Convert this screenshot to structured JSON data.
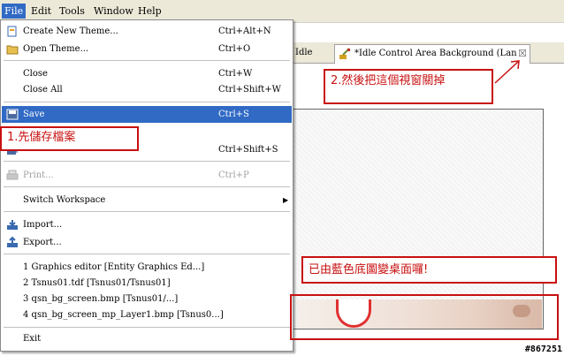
{
  "menubar": {
    "items": [
      {
        "label": "File"
      },
      {
        "label": "Edit"
      },
      {
        "label": "Tools"
      },
      {
        "label": "Window"
      },
      {
        "label": "Help"
      }
    ]
  },
  "tabs": {
    "inactive_label": "Idle",
    "active_label": "*Idle Control Area Background (Lan",
    "close_glyph": "☒"
  },
  "file_menu": {
    "items": [
      {
        "label": "Create New Theme...",
        "accel": "Ctrl+Alt+N",
        "icon": "new-theme-icon"
      },
      {
        "label": "Open Theme...",
        "accel": "Ctrl+O",
        "icon": "folder-icon"
      },
      {
        "label": "Close",
        "accel": "Ctrl+W"
      },
      {
        "label": "Close All",
        "accel": "Ctrl+Shift+W"
      },
      {
        "label": "Save",
        "accel": "Ctrl+S",
        "icon": "save-icon"
      },
      {
        "label": "",
        "accel": "Ctrl+Shift+S",
        "icon": "save-all-icon"
      },
      {
        "label": "Print...",
        "accel": "Ctrl+P",
        "icon": "print-icon"
      },
      {
        "label": "Switch Workspace",
        "arrow": "▶"
      },
      {
        "label": "Import...",
        "icon": "import-icon"
      },
      {
        "label": "Export...",
        "icon": "export-icon"
      },
      {
        "label": "1 Graphics editor  [Entity Graphics Ed...]"
      },
      {
        "label": "2 Tsnus01.tdf  [Tsnus01/Tsnus01]"
      },
      {
        "label": "3 qsn_bg_screen.bmp  [Tsnus01/...]"
      },
      {
        "label": "4 qsn_bg_screen_mp_Layer1.bmp  [Tsnus0...]"
      },
      {
        "label": "Exit"
      }
    ]
  },
  "callouts": {
    "save_note": "1.先儲存檔案",
    "close_note": "2.然後把這個視窗關掉",
    "result_note": "已由藍色底圖變桌面囉!"
  },
  "watermark": "#867251",
  "colors": {
    "highlight": "#316ac5",
    "callout_red": "#c81010"
  }
}
